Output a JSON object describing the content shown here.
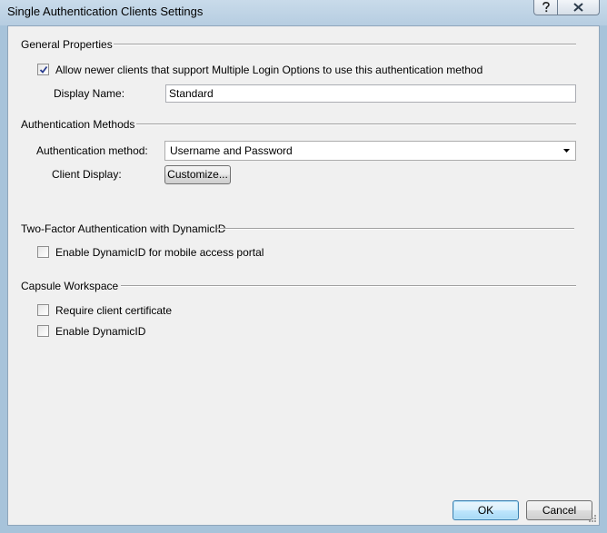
{
  "window": {
    "title": "Single Authentication Clients Settings"
  },
  "titlebar_buttons": {
    "help_icon": "question-mark-icon",
    "close_icon": "close-x-icon"
  },
  "general_properties": {
    "heading": "General Properties",
    "allow_newer_clients": {
      "label": "Allow newer clients that support Multiple Login Options to use this authentication method",
      "checked": true
    },
    "display_name": {
      "label": "Display Name:",
      "value": "Standard"
    }
  },
  "authentication_methods": {
    "heading": "Authentication Methods",
    "method": {
      "label": "Authentication method:",
      "selected": "Username and Password"
    },
    "client_display": {
      "label": "Client Display:",
      "button_label": "Customize..."
    }
  },
  "two_factor": {
    "heading": "Two-Factor Authentication with DynamicID",
    "enable_dynamicid_portal": {
      "label": "Enable DynamicID for mobile access portal",
      "checked": false
    }
  },
  "capsule_workspace": {
    "heading": "Capsule Workspace",
    "require_client_certificate": {
      "label": "Require client certificate",
      "checked": false
    },
    "enable_dynamicid": {
      "label": "Enable DynamicID",
      "checked": false
    }
  },
  "footer": {
    "ok_label": "OK",
    "cancel_label": "Cancel"
  }
}
